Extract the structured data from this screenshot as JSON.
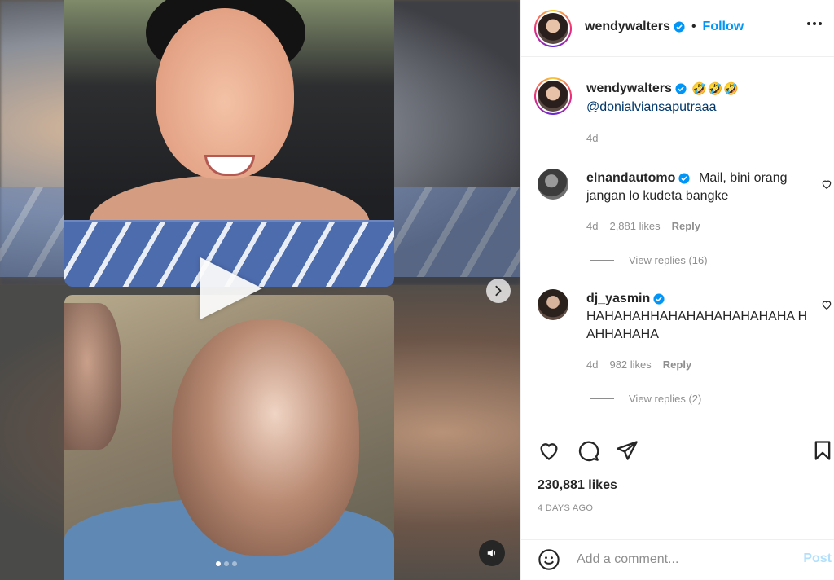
{
  "post": {
    "author": "wendywalters",
    "follow_label": "Follow",
    "bullet": "•",
    "caption_emojis": "🤣🤣🤣",
    "caption_mention": "@donialviansaputraaa",
    "caption_time": "4d"
  },
  "comments": [
    {
      "user": "elnandautomo",
      "text": "Mail, bini orang jangan lo kudeta bangke",
      "time": "4d",
      "likes": "2,881 likes",
      "reply_label": "Reply",
      "view_replies": "View replies (16)"
    },
    {
      "user": "dj_yasmin",
      "text": "HAHAHAHHAHAHAHAHAHAHAHA HAHHAHAHA",
      "time": "4d",
      "likes": "982 likes",
      "reply_label": "Reply",
      "view_replies": "View replies (2)"
    }
  ],
  "stats": {
    "likes": "230,881 likes",
    "date": "4 DAYS AGO"
  },
  "comment_box": {
    "placeholder": "Add a comment...",
    "post_label": "Post"
  },
  "icons": {
    "verified": "verified-badge-icon",
    "heart": "heart-icon",
    "comment": "comment-icon",
    "share": "share-icon",
    "save": "bookmark-icon",
    "emoji": "emoji-icon",
    "more": "more-options-icon",
    "next": "chevron-right-icon",
    "audio": "audio-icon",
    "play": "play-icon"
  },
  "colors": {
    "accent": "#0095f6",
    "mention": "#00376b",
    "muted": "#8e8e8e",
    "post_disabled": "#b2dffc"
  },
  "carousel": {
    "slides": 3,
    "active_index": 0
  }
}
